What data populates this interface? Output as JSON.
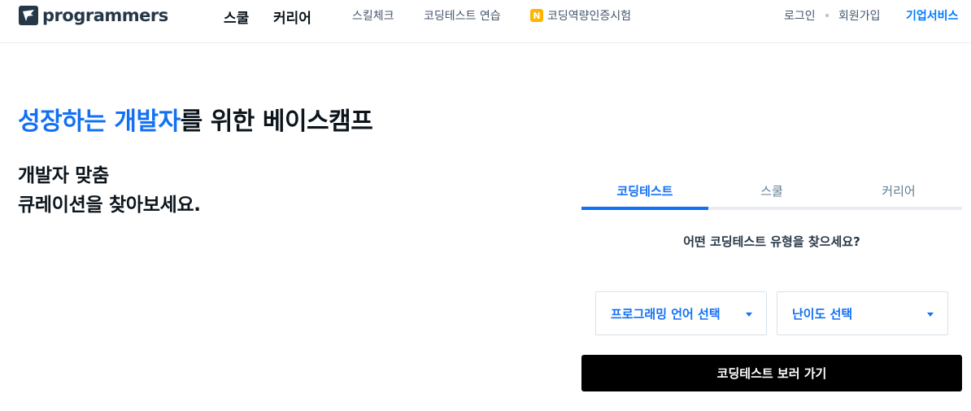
{
  "header": {
    "logo_text": "programmers",
    "nav_main": [
      "스쿨",
      "커리어"
    ],
    "nav_sub": [
      "스킬체크",
      "코딩테스트 연습"
    ],
    "certification": {
      "badge": "N",
      "label": "코딩역량인증시험",
      "badge_color": "#ffb400"
    },
    "login": "로그인",
    "signup": "회원가입",
    "business": "기업서비스"
  },
  "hero": {
    "title_accent": "성장하는 개발자",
    "title_rest": "를 위한 베이스캠프",
    "subtitle_line1": "개발자 맞춤",
    "subtitle_line2": "큐레이션을 찾아보세요."
  },
  "panel": {
    "tabs": [
      {
        "label": "코딩테스트",
        "active": true
      },
      {
        "label": "스쿨",
        "active": false
      },
      {
        "label": "커리어",
        "active": false
      }
    ],
    "question": "어떤 코딩테스트 유형을 찾으세요?",
    "language_select": "프로그래밍 언어 선택",
    "difficulty_select": "난이도 선택",
    "go_button": "코딩테스트 보러 가기"
  },
  "colors": {
    "accent": "#1270f5",
    "business_link": "#0078ff",
    "button_bg": "#000000"
  },
  "icons": {
    "logo": "programmers-logo-icon",
    "select_caret": "caret-down-icon"
  }
}
